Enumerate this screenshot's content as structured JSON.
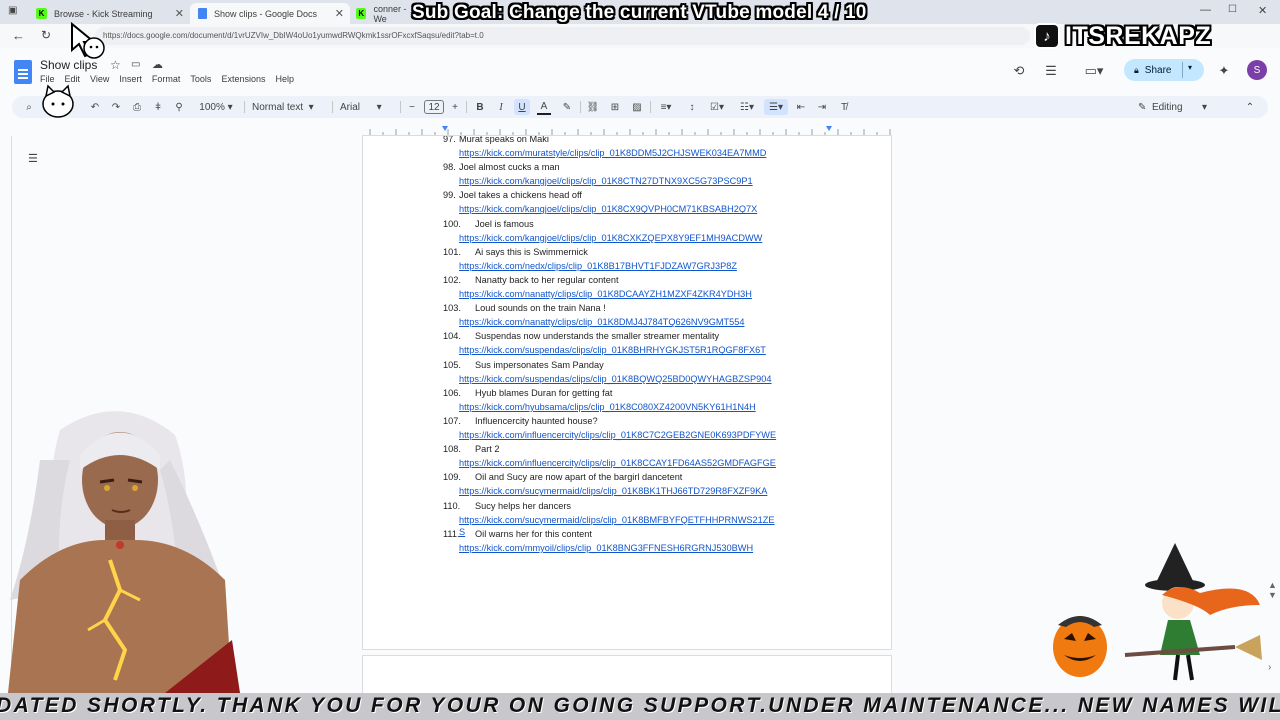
{
  "browser": {
    "tabs": [
      {
        "label": "Browse - Kick Streaming",
        "favicon": "kick-icon",
        "active": false
      },
      {
        "label": "Show clips - Google Docs",
        "favicon": "docs-icon",
        "active": true
      },
      {
        "label": "conner - We",
        "favicon": "kick-icon",
        "active": false
      }
    ],
    "url": "https://docs.google.com/document/d/1vrUZVIw_DbIW4oUo1yumwdRWQkmk1ssrOFxcxfSaqsu/edit?tab=t.0"
  },
  "overlay": {
    "subgoal": "Sub Goal: Change the current VTube model  4 / 10",
    "brand": "ITSREKAPZ",
    "ticker": "DATED SHORTLY. THANK YOU FOR YOUR ON GOING SUPPORT.UNDER MAINTENANCE... NEW NAMES WILL"
  },
  "doc": {
    "title": "Show clips",
    "menus": [
      "File",
      "Edit",
      "View",
      "Insert",
      "Format",
      "Tools",
      "Extensions",
      "Help"
    ],
    "share_label": "Share",
    "avatar_initial": "S"
  },
  "toolbar": {
    "zoom": "100%",
    "style": "Normal text",
    "font": "Arial",
    "size": "12",
    "mode": "Editing"
  },
  "entries": [
    {
      "num": "97.",
      "title": "Murat speaks on Maki",
      "url": "https://kick.com/muratstyle/clips/clip_01K8DDM5J2CHJSWEK034EA7MMD"
    },
    {
      "num": "98.",
      "title": "Joel almost cucks a man",
      "url": "https://kick.com/kangjoel/clips/clip_01K8CTN27DTNX9XC5G73PSC9P1"
    },
    {
      "num": "99.",
      "title": "Joel takes a chickens head off",
      "url": "https://kick.com/kangjoel/clips/clip_01K8CX9QVPH0CM71KBSABH2Q7X"
    },
    {
      "num": "100.",
      "title": "Joel is famous",
      "url": "https://kick.com/kangjoel/clips/clip_01K8CXKZQEPX8Y9EF1MH9ACDWW"
    },
    {
      "num": "101.",
      "title": "Ai says this is Swimmernick",
      "url": "https://kick.com/nedx/clips/clip_01K8B17BHVT1FJDZAW7GRJ3P8Z"
    },
    {
      "num": "102.",
      "title": "Nanatty back to her regular content",
      "url": "https://kick.com/nanatty/clips/clip_01K8DCAAYZH1MZXF4ZKR4YDH3H"
    },
    {
      "num": "103.",
      "title": "Loud sounds on the train Nana !",
      "url": "https://kick.com/nanatty/clips/clip_01K8DMJ4J784TQ626NV9GMT554"
    },
    {
      "num": "104.",
      "title": "Suspendas now understands the smaller streamer mentality",
      "url": "https://kick.com/suspendas/clips/clip_01K8BHRHYGKJST5R1RQGF8FX6T"
    },
    {
      "num": "105.",
      "title": "Sus impersonates Sam Panday",
      "url": "https://kick.com/suspendas/clips/clip_01K8BQWQ25BD0QWYHAGBZSP904"
    },
    {
      "num": "106.",
      "title": "Hyub blames Duran for getting fat",
      "url": "https://kick.com/hyubsama/clips/clip_01K8C080XZ4200VN5KY61H1N4H"
    },
    {
      "num": "107.",
      "title": "Influencercity haunted house?",
      "url": "https://kick.com/influencercity/clips/clip_01K8C7C2GEB2GNE0K693PDFYWE"
    },
    {
      "num": "108.",
      "title": "Part 2",
      "url": "https://kick.com/influencercity/clips/clip_01K8CCAY1FD64AS52GMDFAGFGE"
    },
    {
      "num": "109.",
      "title": "Oil and Sucy are now apart of the bargirl dancetent",
      "url": "https://kick.com/sucymermaid/clips/clip_01K8BK1THJ66TD729R8FXZF9KA"
    },
    {
      "num": "110.",
      "title": "Sucy helps her dancers",
      "url": "https://kick.com/sucymermaid/clips/clip_01K8BMFBYFQETFHHPRNWS21ZE",
      "url_tail": "S"
    },
    {
      "num": "111.",
      "title": "Oil warns her for this content",
      "url": "https://kick.com/mmyoil/clips/clip_01K8BNG3FFNESH6RGRNJ530BWH"
    }
  ],
  "colors": {
    "link": "#1155cc",
    "share_bg": "#c2e7ff",
    "kick_green": "#53fc18",
    "docs_blue": "#4285f4"
  }
}
